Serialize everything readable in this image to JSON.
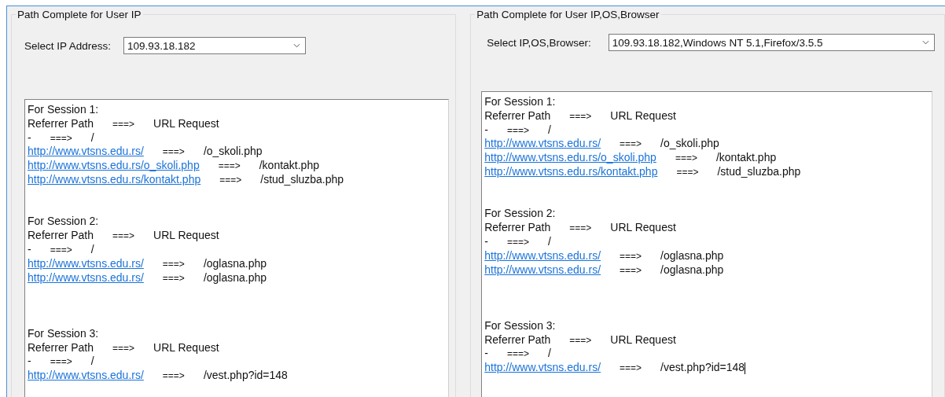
{
  "panels": [
    {
      "title": "Path Complete for User IP",
      "kind": "ip",
      "selector": {
        "label": "Select IP Address:",
        "value": "109.93.18.182"
      },
      "log": {
        "focused": false,
        "lines": [
          {
            "kind": "text",
            "text": "For Session 1:"
          },
          {
            "kind": "row",
            "referrer": "Referrer Path",
            "arrow": "===>",
            "request": "URL Request",
            "link": false
          },
          {
            "kind": "row",
            "referrer": "-",
            "arrow": "===>",
            "request": "/",
            "link": false
          },
          {
            "kind": "row",
            "referrer": "http://www.vtsns.edu.rs/",
            "arrow": "===>",
            "request": "/o_skoli.php",
            "link": true
          },
          {
            "kind": "row",
            "referrer": "http://www.vtsns.edu.rs/o_skoli.php",
            "arrow": "===>",
            "request": "/kontakt.php",
            "link": true
          },
          {
            "kind": "row",
            "referrer": "http://www.vtsns.edu.rs/kontakt.php",
            "arrow": "===>",
            "request": "/stud_sluzba.php",
            "link": true
          },
          {
            "kind": "blank"
          },
          {
            "kind": "blank"
          },
          {
            "kind": "text",
            "text": "For Session 2:"
          },
          {
            "kind": "row",
            "referrer": "Referrer Path",
            "arrow": "===>",
            "request": "URL Request",
            "link": false
          },
          {
            "kind": "row",
            "referrer": "-",
            "arrow": "===>",
            "request": "/",
            "link": false
          },
          {
            "kind": "row",
            "referrer": "http://www.vtsns.edu.rs/",
            "arrow": "===>",
            "request": "/oglasna.php",
            "link": true
          },
          {
            "kind": "row",
            "referrer": "http://www.vtsns.edu.rs/",
            "arrow": "===>",
            "request": "/oglasna.php",
            "link": true
          },
          {
            "kind": "blank"
          },
          {
            "kind": "blank"
          },
          {
            "kind": "blank"
          },
          {
            "kind": "text",
            "text": "For Session 3:"
          },
          {
            "kind": "row",
            "referrer": "Referrer Path",
            "arrow": "===>",
            "request": "URL Request",
            "link": false
          },
          {
            "kind": "row",
            "referrer": "-",
            "arrow": "===>",
            "request": "/",
            "link": false
          },
          {
            "kind": "row",
            "referrer": "http://www.vtsns.edu.rs/",
            "arrow": "===>",
            "request": "/vest.php?id=148",
            "link": true
          }
        ]
      }
    },
    {
      "title": "Path Complete for User IP,OS,Browser",
      "kind": "browser",
      "selector": {
        "label": "Select IP,OS,Browser:",
        "value": "109.93.18.182,Windows NT 5.1,Firefox/3.5.5"
      },
      "log": {
        "focused": true,
        "lines": [
          {
            "kind": "text",
            "text": "For Session 1:"
          },
          {
            "kind": "row",
            "referrer": "Referrer Path",
            "arrow": "===>",
            "request": "URL Request",
            "link": false
          },
          {
            "kind": "row",
            "referrer": "-",
            "arrow": "===>",
            "request": "/",
            "link": false
          },
          {
            "kind": "row",
            "referrer": "http://www.vtsns.edu.rs/",
            "arrow": "===>",
            "request": "/o_skoli.php",
            "link": true
          },
          {
            "kind": "row",
            "referrer": "http://www.vtsns.edu.rs/o_skoli.php",
            "arrow": "===>",
            "request": "/kontakt.php",
            "link": true
          },
          {
            "kind": "row",
            "referrer": "http://www.vtsns.edu.rs/kontakt.php",
            "arrow": "===>",
            "request": "/stud_sluzba.php",
            "link": true
          },
          {
            "kind": "blank"
          },
          {
            "kind": "blank"
          },
          {
            "kind": "text",
            "text": "For Session 2:"
          },
          {
            "kind": "row",
            "referrer": "Referrer Path",
            "arrow": "===>",
            "request": "URL Request",
            "link": false
          },
          {
            "kind": "row",
            "referrer": "-",
            "arrow": "===>",
            "request": "/",
            "link": false
          },
          {
            "kind": "row",
            "referrer": "http://www.vtsns.edu.rs/",
            "arrow": "===>",
            "request": "/oglasna.php",
            "link": true
          },
          {
            "kind": "row",
            "referrer": "http://www.vtsns.edu.rs/",
            "arrow": "===>",
            "request": "/oglasna.php",
            "link": true
          },
          {
            "kind": "blank"
          },
          {
            "kind": "blank"
          },
          {
            "kind": "blank"
          },
          {
            "kind": "text",
            "text": "For Session 3:"
          },
          {
            "kind": "row",
            "referrer": "Referrer Path",
            "arrow": "===>",
            "request": "URL Request",
            "link": false
          },
          {
            "kind": "row",
            "referrer": "-",
            "arrow": "===>",
            "request": "/",
            "link": false
          },
          {
            "kind": "row",
            "referrer": "http://www.vtsns.edu.rs/",
            "arrow": "===>",
            "request": "/vest.php?id=148",
            "link": true
          }
        ]
      }
    }
  ]
}
